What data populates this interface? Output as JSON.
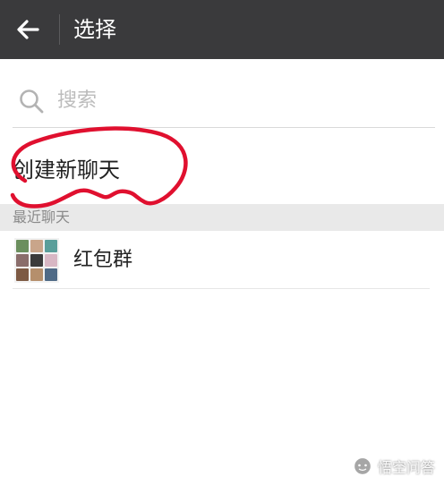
{
  "header": {
    "back_icon": "arrow-left-icon",
    "title": "选择"
  },
  "search": {
    "icon": "search-icon",
    "placeholder": "搜索",
    "value": ""
  },
  "create_chat": {
    "label": "创建新聊天"
  },
  "recent": {
    "section_label": "最近聊天",
    "items": [
      {
        "name": "红包群",
        "avatar_icon": "group-avatar-icon"
      }
    ]
  },
  "annotation": {
    "color": "#e0102f"
  },
  "watermark": {
    "text": "悟空问答",
    "icon": "wukong-logo-icon"
  },
  "colors": {
    "topbar": "#3a3a3c",
    "section_header": "#e9e9e9"
  }
}
